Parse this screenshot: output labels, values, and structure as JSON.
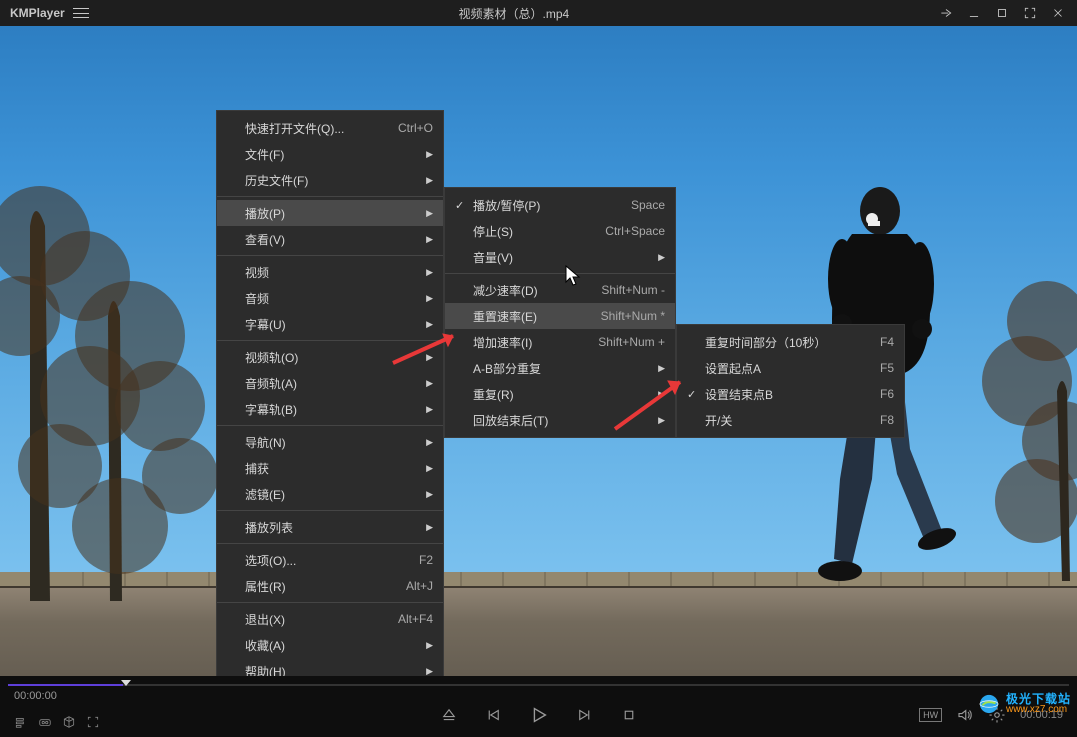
{
  "title_bar": {
    "app_name": "KMPlayer",
    "file_title": "视频素材（总）.mp4"
  },
  "menu1": {
    "groups": [
      [
        {
          "label": "快速打开文件(Q)...",
          "shortcut": "Ctrl+O",
          "arrow": false
        },
        {
          "label": "文件(F)",
          "shortcut": "",
          "arrow": true
        },
        {
          "label": "历史文件(F)",
          "shortcut": "",
          "arrow": true
        }
      ],
      [
        {
          "label": "播放(P)",
          "shortcut": "",
          "arrow": true,
          "highlight": true
        },
        {
          "label": "查看(V)",
          "shortcut": "",
          "arrow": true
        }
      ],
      [
        {
          "label": "视频",
          "shortcut": "",
          "arrow": true
        },
        {
          "label": "音频",
          "shortcut": "",
          "arrow": true
        },
        {
          "label": "字幕(U)",
          "shortcut": "",
          "arrow": true
        }
      ],
      [
        {
          "label": "视频轨(O)",
          "shortcut": "",
          "arrow": true
        },
        {
          "label": "音频轨(A)",
          "shortcut": "",
          "arrow": true
        },
        {
          "label": "字幕轨(B)",
          "shortcut": "",
          "arrow": true
        }
      ],
      [
        {
          "label": "导航(N)",
          "shortcut": "",
          "arrow": true
        },
        {
          "label": "捕获",
          "shortcut": "",
          "arrow": true
        },
        {
          "label": "滤镜(E)",
          "shortcut": "",
          "arrow": true
        }
      ],
      [
        {
          "label": "播放列表",
          "shortcut": "",
          "arrow": true
        }
      ],
      [
        {
          "label": "选项(O)...",
          "shortcut": "F2",
          "arrow": false
        },
        {
          "label": "属性(R)",
          "shortcut": "Alt+J",
          "arrow": false
        }
      ],
      [
        {
          "label": "退出(X)",
          "shortcut": "Alt+F4",
          "arrow": false
        },
        {
          "label": "收藏(A)",
          "shortcut": "",
          "arrow": true
        },
        {
          "label": "帮助(H)",
          "shortcut": "",
          "arrow": true
        }
      ]
    ]
  },
  "menu2": {
    "groups": [
      [
        {
          "check": true,
          "label": "播放/暂停(P)",
          "shortcut": "Space",
          "arrow": false
        },
        {
          "label": "停止(S)",
          "shortcut": "Ctrl+Space",
          "arrow": false
        },
        {
          "label": "音量(V)",
          "shortcut": "",
          "arrow": true
        }
      ],
      [
        {
          "label": "减少速率(D)",
          "shortcut": "Shift+Num -",
          "arrow": false
        },
        {
          "label": "重置速率(E)",
          "shortcut": "Shift+Num *",
          "arrow": false,
          "highlight": true
        },
        {
          "label": "增加速率(I)",
          "shortcut": "Shift+Num +",
          "arrow": false
        },
        {
          "label": "A-B部分重复",
          "shortcut": "",
          "arrow": true
        },
        {
          "label": "重复(R)",
          "shortcut": "",
          "arrow": true
        },
        {
          "label": "回放结束后(T)",
          "shortcut": "",
          "arrow": true
        }
      ]
    ]
  },
  "menu3": {
    "items": [
      {
        "label": "重复时间部分（10秒）",
        "shortcut": "F4"
      },
      {
        "label": "设置起点A",
        "shortcut": "F5"
      },
      {
        "check": true,
        "label": "设置结束点B",
        "shortcut": "F6"
      },
      {
        "label": "开/关",
        "shortcut": "F8"
      }
    ]
  },
  "controls": {
    "current_time_display": "00:00:00",
    "right_time": "00:00:19",
    "hw_label": "HW"
  },
  "watermark": {
    "line1": "极光下载站",
    "line2": "www.xz7.com"
  }
}
